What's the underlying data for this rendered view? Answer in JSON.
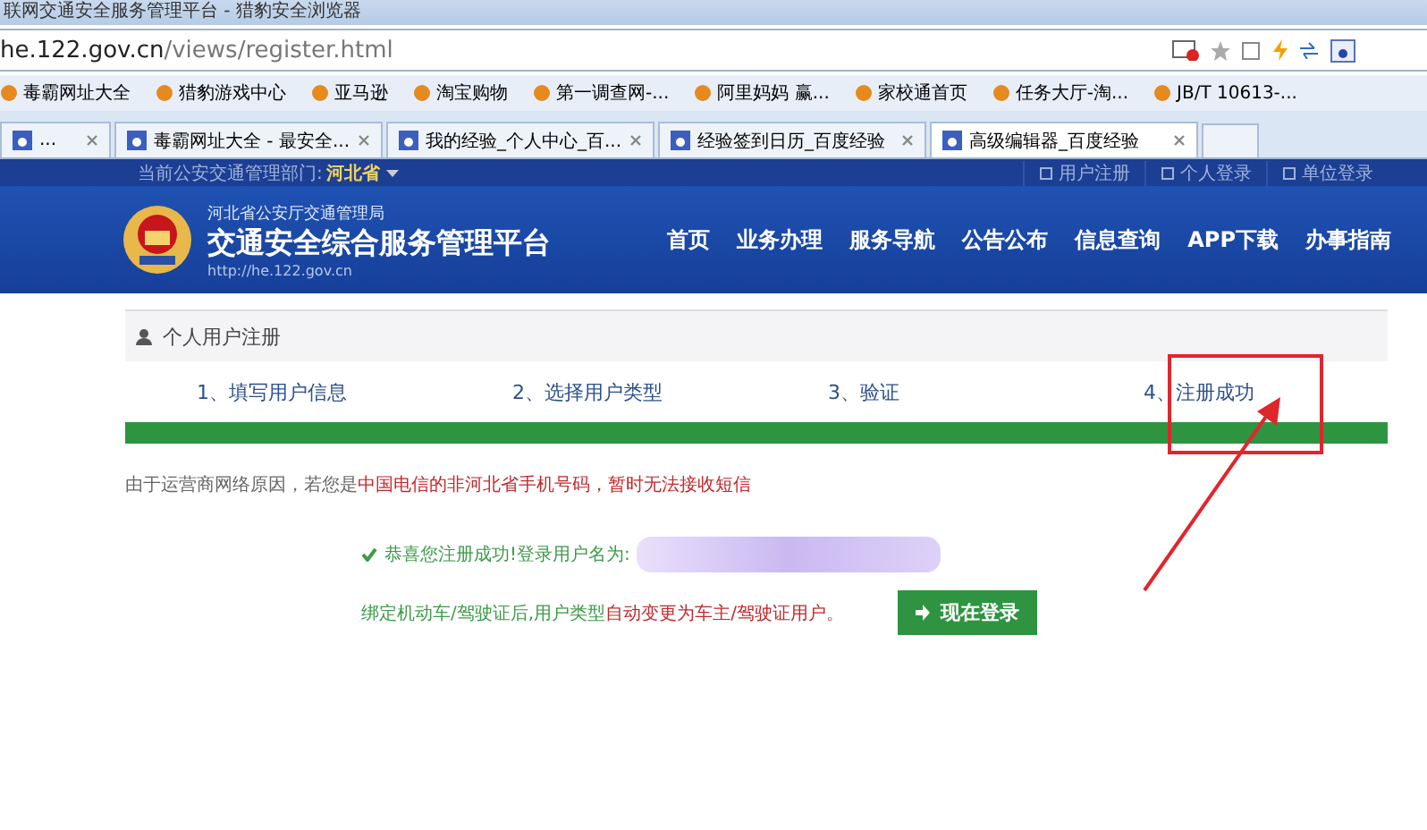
{
  "window": {
    "title": "联网交通安全服务管理平台 - 猎豹安全浏览器"
  },
  "address_bar": {
    "host": "he.122.gov.cn",
    "path": "/views/register.html"
  },
  "bookmarks": [
    "毒霸网址大全",
    "猎豹游戏中心",
    "亚马逊",
    "淘宝购物",
    "第一调查网-...",
    "阿里妈妈 赢...",
    "家校通首页",
    "任务大厅-淘...",
    "JB/T 10613-..."
  ],
  "tabs": [
    {
      "label": "...",
      "selected": false
    },
    {
      "label": "毒霸网址大全 - 最安全...",
      "selected": false
    },
    {
      "label": "我的经验_个人中心_百...",
      "selected": false
    },
    {
      "label": "经验签到日历_百度经验",
      "selected": false
    },
    {
      "label": "高级编辑器_百度经验",
      "selected": true
    }
  ],
  "site_top_bar": {
    "department_label": "当前公安交通管理部门:",
    "department": "河北省",
    "links": [
      "用户注册",
      "个人登录",
      "单位登录"
    ]
  },
  "site_header": {
    "subtitle": "河北省公安厅交通管理局",
    "title": "交通安全综合服务管理平台",
    "url": "http://he.122.gov.cn",
    "nav": [
      "首页",
      "业务办理",
      "服务导航",
      "公告公布",
      "信息查询",
      "APP下载",
      "办事指南"
    ]
  },
  "panel": {
    "title": "个人用户注册",
    "steps": [
      "1、填写用户信息",
      "2、选择用户类型",
      "3、验证",
      "4、注册成功"
    ],
    "progress": {
      "level": 1
    },
    "notice": [
      {
        "text": "由于运营商网络原因，若您是",
        "highlight": false
      },
      {
        "text": "中国电信的非河北省手机号码，",
        "highlight": true
      },
      {
        "text": "暂时无法接收短信",
        "highlight": true
      }
    ],
    "success": "恭喜您注册成功!登录用户名为:",
    "hint": [
      {
        "text": "绑定机动车/驾驶证后,用户类型",
        "highlight": false
      },
      {
        "text": "自动变更为车主/驾驶证用户。",
        "highlight": true
      }
    ],
    "login_button": "现在登录"
  }
}
